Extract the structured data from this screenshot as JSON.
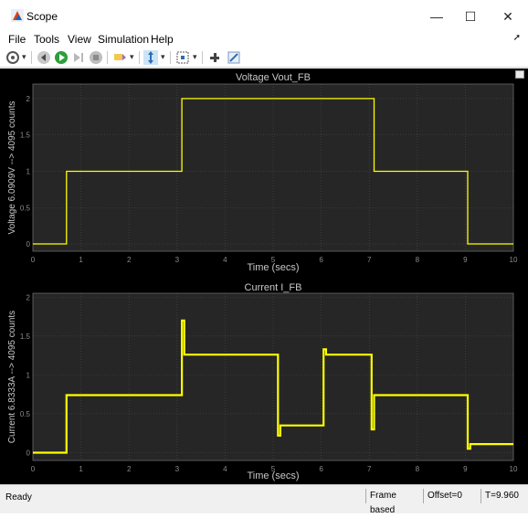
{
  "window": {
    "title": "Scope"
  },
  "menu": [
    "File",
    "Tools",
    "View",
    "Simulation",
    "Help"
  ],
  "toolbar_icons": [
    "settings-icon",
    "step-back-icon",
    "run-icon",
    "step-forward-icon",
    "stop-icon",
    "highlight-icon",
    "zoom-icon",
    "fit-view-icon",
    "cursor-icon",
    "edit-icon"
  ],
  "colors": {
    "plot_bg": "#000000",
    "axes_bg": "#262626",
    "axes_fg": "#8c8c8c",
    "title": "#c8c8c8",
    "trace": "#ffff00"
  },
  "status": {
    "ready": "Ready",
    "mode": "Frame based",
    "offset": "Offset=0",
    "time": "T=9.960"
  },
  "chart_data": [
    {
      "type": "line",
      "title": "Voltage Vout_FB",
      "xlabel": "Time (secs)",
      "ylabel": "Voltage 6.0909V --> 4095 counts",
      "xlim": [
        0,
        10
      ],
      "ylim": [
        -0.1,
        2.2
      ],
      "xticks": [
        0,
        1,
        2,
        3,
        4,
        5,
        6,
        7,
        8,
        9,
        10
      ],
      "yticks": [
        0,
        0.5,
        1,
        1.5,
        2
      ],
      "ytick_labels": [
        "0",
        "0.5",
        "1",
        "1.5",
        "2"
      ],
      "grid": true,
      "series": [
        {
          "x": [
            0,
            0.7,
            0.7,
            3.1,
            3.1,
            7.1,
            7.1,
            9.05,
            9.05,
            10
          ],
          "y": [
            0,
            0,
            1,
            1,
            2,
            2,
            1,
            1,
            0,
            0
          ]
        }
      ]
    },
    {
      "type": "line",
      "title": "Current I_FB",
      "xlabel": "Time (secs)",
      "ylabel": "Current 6.8333A --> 4095 counts",
      "xlim": [
        0,
        10
      ],
      "ylim": [
        -0.1,
        2.05
      ],
      "xticks": [
        0,
        1,
        2,
        3,
        4,
        5,
        6,
        7,
        8,
        9,
        10
      ],
      "yticks": [
        0,
        0.5,
        1,
        1.5,
        2
      ],
      "ytick_labels": [
        "0",
        "0.5",
        "1",
        "1.5",
        "2"
      ],
      "grid": true,
      "series": [
        {
          "x": [
            0,
            0.7,
            0.7,
            3.1,
            3.1,
            3.15,
            3.15,
            5.1,
            5.1,
            5.15,
            5.15,
            6.05,
            6.05,
            6.1,
            6.1,
            7.05,
            7.05,
            7.1,
            7.1,
            9.05,
            9.05,
            9.1,
            9.1,
            10
          ],
          "y": [
            0,
            0,
            0.74,
            0.74,
            1.7,
            1.7,
            1.26,
            1.26,
            0.22,
            0.22,
            0.35,
            0.35,
            1.33,
            1.33,
            1.26,
            1.26,
            0.3,
            0.3,
            0.74,
            0.74,
            0.05,
            0.05,
            0.11,
            0.11
          ]
        }
      ]
    }
  ]
}
